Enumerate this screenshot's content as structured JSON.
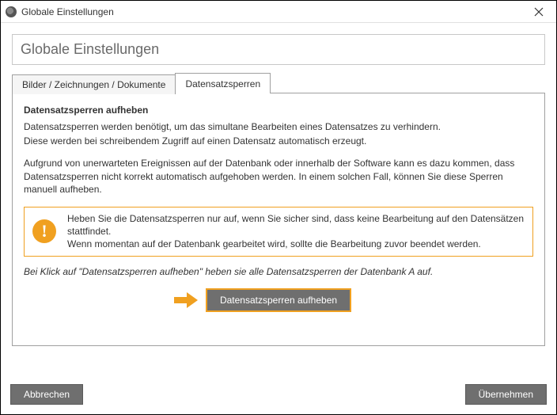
{
  "window": {
    "title": "Globale Einstellungen"
  },
  "header": {
    "title": "Globale Einstellungen"
  },
  "tabs": [
    {
      "label": "Bilder / Zeichnungen / Dokumente"
    },
    {
      "label": "Datensatzsperren"
    }
  ],
  "section": {
    "heading": "Datensatzsperren aufheben",
    "p1": "Datensatzsperren werden benötigt, um das simultane Bearbeiten eines Datensatzes zu verhindern.",
    "p2": "Diese werden bei schreibendem Zugriff auf einen Datensatz automatisch erzeugt.",
    "p3": "Aufgrund von unerwarteten Ereignissen auf der Datenbank oder innerhalb der Software kann es dazu kommen, dass Datensatzsperren nicht korrekt automatisch aufgehoben werden. In einem solchen Fall, können Sie diese Sperren manuell aufheben."
  },
  "warning": {
    "line1": "Heben Sie die Datensatzsperren nur auf, wenn Sie sicher sind, dass keine Bearbeitung auf den Datensätzen stattfindet.",
    "line2": "Wenn momentan auf der Datenbank gearbeitet wird, sollte die Bearbeitung zuvor beendet werden."
  },
  "instruction": "Bei Klick auf \"Datensatzsperren aufheben\" heben sie alle Datensatzsperren der Datenbank A auf.",
  "action": {
    "button": "Datensatzsperren aufheben"
  },
  "footer": {
    "cancel": "Abbrechen",
    "apply": "Übernehmen"
  }
}
